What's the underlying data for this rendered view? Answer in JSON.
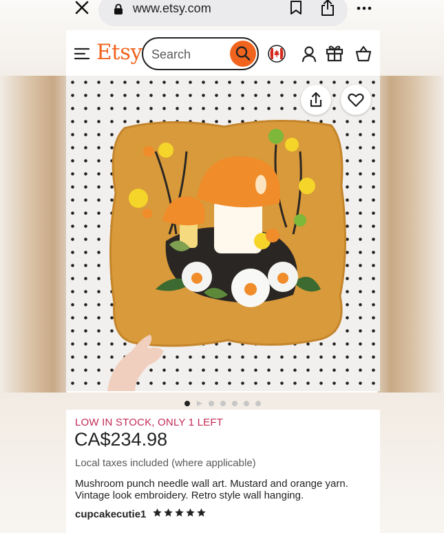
{
  "browser": {
    "url": "www.etsy.com"
  },
  "header": {
    "logo": "Etsy",
    "search": {
      "placeholder": "Search"
    }
  },
  "gallery": {
    "image_count": 7,
    "active_index": 0
  },
  "product": {
    "stock_notice": "LOW IN STOCK, ONLY 1 LEFT",
    "price": "CA$234.98",
    "taxes": "Local taxes included (where applicable)",
    "description": "Mushroom punch needle wall art. Mustard and orange yarn. Vintage look embroidery. Retro style wall hanging.",
    "shop_name": "cupcakecutie1",
    "rating": 5
  },
  "colors": {
    "brand": "#f1641e",
    "stock_alert": "#c22a54",
    "mustard_rug": "#d89a3a"
  }
}
